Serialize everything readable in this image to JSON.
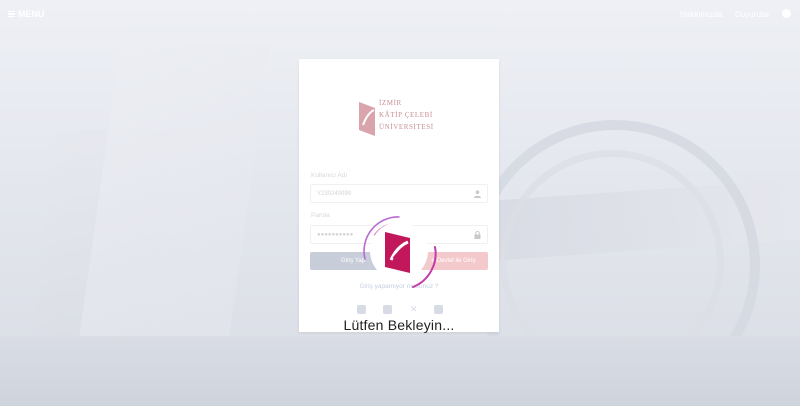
{
  "topbar": {
    "menu_label": "MENU",
    "nav": {
      "about": "Hakkımızda",
      "announcements": "Duyurular"
    }
  },
  "logo": {
    "line1": "İZMİR",
    "line2": "KÂTİP ÇELEBİ",
    "line3": "ÜNİVERSİTESİ"
  },
  "login": {
    "username_label": "Kullanıcı Adı",
    "username_value": "Y230240099",
    "password_label": "Parola",
    "password_value": "●●●●●●●●●●",
    "login_button": "Giriş Yap",
    "edevlet_button": "e-Devlet ile Giriş",
    "forgot_link": "Giriş yapamıyor musunuz ?"
  },
  "social_icons": [
    "instagram-icon",
    "facebook-icon",
    "x-twitter-icon",
    "youtube-icon"
  ],
  "loading": {
    "text": "Lütfen Bekleyin..."
  },
  "colors": {
    "brand": "#c2185b",
    "spinner": "#c33aa8"
  }
}
